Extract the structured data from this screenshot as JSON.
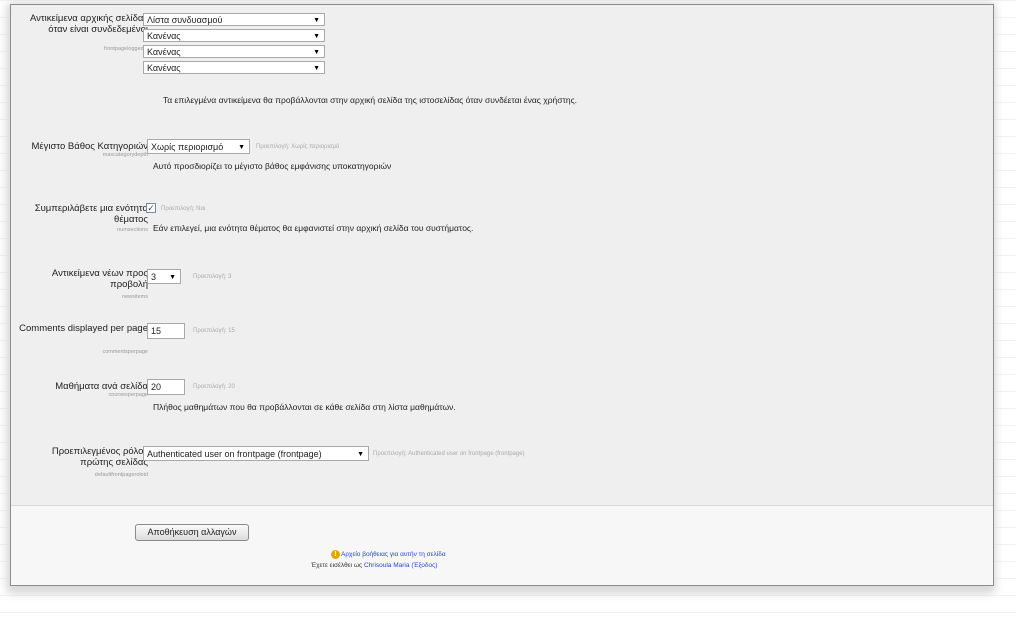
{
  "frontpage_items": {
    "label": "Αντικείμενα αρχικής σελίδας όταν είναι συνδεδεμένοι",
    "setting_name": "frontpageloggedin",
    "selects": [
      "Λίστα συνδυασμού",
      "Κανένας",
      "Κανένας",
      "Κανένας"
    ],
    "description": "Τα επιλεγμένα αντικείμενα θα προβάλλονται στην αρχική σελίδα της ιστοσελίδας όταν συνδέεται ένας χρήστης."
  },
  "max_category_depth": {
    "label": "Μέγιστο Βάθος Κατηγοριών",
    "setting_name": "maxcategorydepth",
    "value": "Χωρίς περιορισμό",
    "default": "Προεπιλογή: Χωρίς περιορισμό",
    "description": "Αυτό προσδιορίζει το μέγιστο βάθος εμφάνισης υποκατηγοριών"
  },
  "include_topic": {
    "label": "Συμπεριλάβετε μια ενότητα θέματος",
    "setting_name": "numsections",
    "checked": "✓",
    "default": "Προεπιλογή: Ναι",
    "description": "Εάν επιλεγεί, μια ενότητα θέματος θα εμφανιστεί στην αρχική σελίδα του συστήματος."
  },
  "news_items": {
    "label": "Αντικείμενα νέων προς προβολή",
    "setting_name": "newsitems",
    "value": "3",
    "default": "Προεπιλογή: 3"
  },
  "comments_per_page": {
    "label": "Comments displayed per page",
    "setting_name": "commentsperpage",
    "value": "15",
    "default": "Προεπιλογή: 15"
  },
  "courses_per_page": {
    "label": "Μαθήματα ανά σελίδα",
    "setting_name": "coursesperpage",
    "value": "20",
    "default": "Προεπιλογή: 20",
    "description": "Πλήθος μαθημάτων που θα προβάλλονται σε κάθε σελίδα στη λίστα μαθημάτων."
  },
  "default_role": {
    "label": "Προεπιλεγμένος ρόλος πρώτης σελίδας",
    "setting_name": "defaultfrontpageroleid",
    "value": "Authenticated user on frontpage (frontpage)",
    "default": "Προεπιλογή: Authenticated user on frontpage (frontpage)"
  },
  "footer": {
    "save_label": "Αποθήκευση αλλαγών",
    "help_link": "Αρχείο βοήθειας για αυτήν τη σελίδα",
    "login_prefix": "Έχετε εισέλθει ως",
    "user_name": "Chrisoula Maria",
    "logout": "(Έξοδος)",
    "icon": "help-icon",
    "link_color": "#2a47c5"
  }
}
